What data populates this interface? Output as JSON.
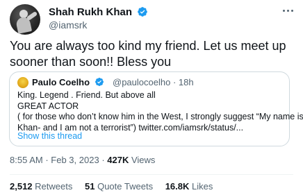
{
  "author": {
    "name": "Shah Rukh Khan",
    "handle": "@iamsrk",
    "verified_color": "#1d9bf0"
  },
  "tweet": {
    "line1": "You are always too kind my friend. Let us meet up",
    "line2": "sooner than soon!! Bless you"
  },
  "quote": {
    "name": "Paulo Coelho",
    "handle": "@paulocoelho",
    "separator": "·",
    "time": "18h",
    "lines": [
      "King. Legend . Friend. But above all",
      "GREAT ACTOR",
      "( for those who don’t know him in the West, I strongly suggest “My name is",
      "Khan- and I am not a terrorist”) twitter.com/iamsrk/status/..."
    ],
    "show_thread": "Show this thread"
  },
  "meta": {
    "time": "8:55 AM",
    "sep1": "·",
    "date": "Feb 3, 2023",
    "sep2": "·",
    "views_count": "427K",
    "views_label": "Views"
  },
  "stats": {
    "retweets_count": "2,512",
    "retweets_label": "Retweets",
    "quotes_count": "51",
    "quotes_label": "Quote Tweets",
    "likes_count": "16.8K",
    "likes_label": "Likes"
  },
  "icons": {
    "more": "more-options-icon",
    "verified": "verified-badge-icon"
  }
}
